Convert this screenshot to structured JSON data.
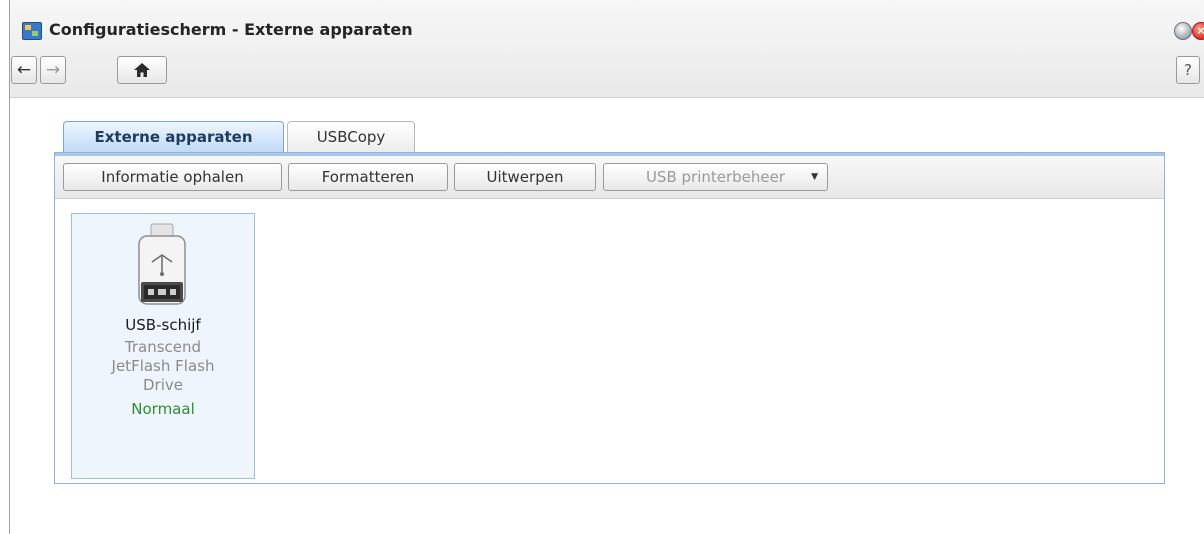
{
  "window": {
    "title": "Configuratiescherm - Externe apparaten"
  },
  "nav": {
    "back_icon": "←",
    "forward_icon": "→",
    "home_icon": "home",
    "help_label": "?"
  },
  "tabs": [
    {
      "label": "Externe apparaten",
      "active": true
    },
    {
      "label": "USBCopy",
      "active": false
    }
  ],
  "toolbar": {
    "info_label": "Informatie ophalen",
    "format_label": "Formatteren",
    "eject_label": "Uitwerpen",
    "printer_label": "USB printerbeheer"
  },
  "device": {
    "name": "USB-schijf",
    "description_lines": [
      "Transcend",
      "JetFlash Flash",
      "Drive"
    ],
    "status": "Normaal"
  },
  "colors": {
    "accent": "#7aa6d6",
    "status_ok": "#2f8f2f"
  }
}
